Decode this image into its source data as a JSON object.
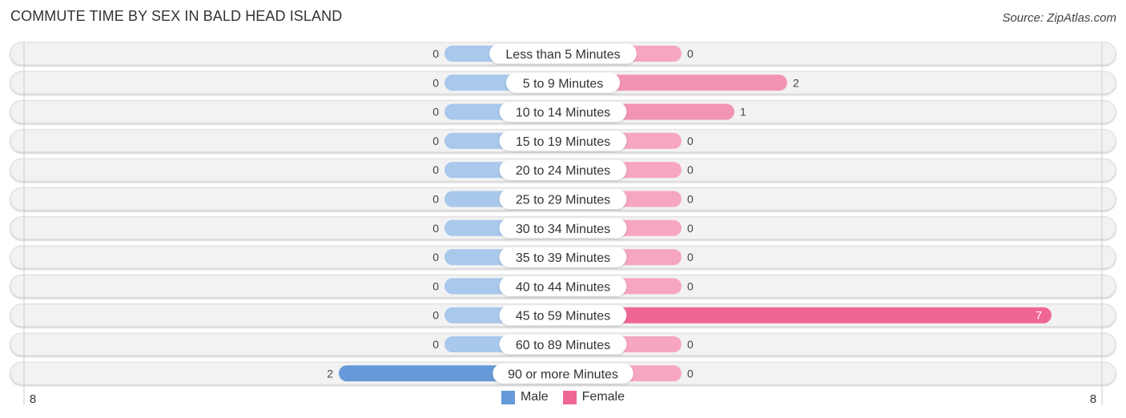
{
  "header": {
    "title": "COMMUTE TIME BY SEX IN BALD HEAD ISLAND",
    "source": "Source: ZipAtlas.com"
  },
  "colors": {
    "male_light": "#a8c8ec",
    "male_strong": "#6699d8",
    "female_light": "#f6a6c0",
    "female_mid": "#f394b4",
    "female_strong": "#f06692",
    "row_bg": "#f2f2f2"
  },
  "legend": {
    "male": "Male",
    "female": "Female"
  },
  "chart_data": {
    "type": "bar",
    "orientation": "horizontal-diverging",
    "title": "COMMUTE TIME BY SEX IN BALD HEAD ISLAND",
    "categories": [
      "Less than 5 Minutes",
      "5 to 9 Minutes",
      "10 to 14 Minutes",
      "15 to 19 Minutes",
      "20 to 24 Minutes",
      "25 to 29 Minutes",
      "30 to 34 Minutes",
      "35 to 39 Minutes",
      "40 to 44 Minutes",
      "45 to 59 Minutes",
      "60 to 89 Minutes",
      "90 or more Minutes"
    ],
    "series": [
      {
        "name": "Male",
        "values": [
          0,
          0,
          0,
          0,
          0,
          0,
          0,
          0,
          0,
          0,
          0,
          2
        ]
      },
      {
        "name": "Female",
        "values": [
          0,
          2,
          1,
          0,
          0,
          0,
          0,
          0,
          0,
          7,
          0,
          0
        ]
      }
    ],
    "axis": {
      "min_label": "8",
      "max_label": "8",
      "range": [
        -8,
        8
      ]
    },
    "legend_position": "bottom-center",
    "grid": false
  }
}
